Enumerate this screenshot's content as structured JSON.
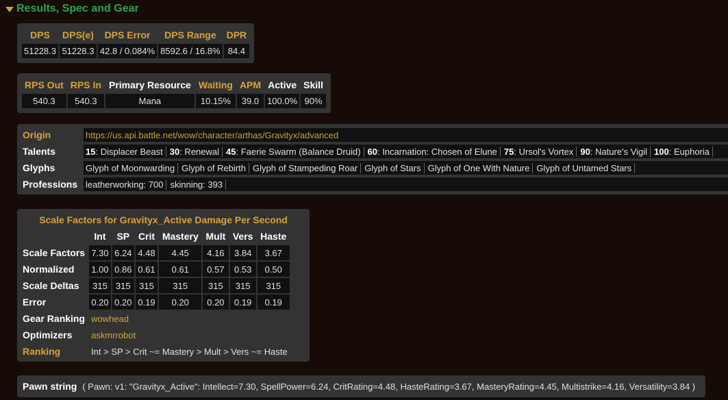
{
  "section": {
    "title": "Results, Spec and Gear"
  },
  "dps_table": {
    "headers": [
      "DPS",
      "DPS(e)",
      "DPS Error",
      "DPS Range",
      "DPR"
    ],
    "values": [
      "51228.3",
      "51228.3",
      "42.8 / 0.084%",
      "8592.6 / 16.8%",
      "84.4"
    ]
  },
  "rps_table": {
    "headers": [
      "RPS Out",
      "RPS In",
      "Primary Resource",
      "Waiting",
      "APM",
      "Active",
      "Skill"
    ],
    "header_colors": [
      "gold",
      "gold",
      "white",
      "gold",
      "gold",
      "white",
      "white"
    ],
    "values": [
      "540.3",
      "540.3",
      "Mana",
      "10.15%",
      "39.0",
      "100.0%",
      "90%"
    ]
  },
  "profile": {
    "origin_label": "Origin",
    "origin_url": "https://us.api.battle.net/wow/character/arthas/Gravityx/advanced",
    "talents_label": "Talents",
    "talents": [
      {
        "level": "15",
        "name": ": Displacer Beast"
      },
      {
        "level": "30",
        "name": ": Renewal"
      },
      {
        "level": "45",
        "name": ": Faerie Swarm (Balance Druid)"
      },
      {
        "level": "60",
        "name": ": Incarnation: Chosen of Elune"
      },
      {
        "level": "75",
        "name": ": Ursol's Vortex"
      },
      {
        "level": "90",
        "name": ": Nature's Vigil"
      },
      {
        "level": "100",
        "name": ": Euphoria"
      }
    ],
    "glyphs_label": "Glyphs",
    "glyphs": [
      "Glyph of Moonwarding",
      "Glyph of Rebirth",
      "Glyph of Stampeding Roar",
      "Glyph of Stars",
      "Glyph of One With Nature",
      "Glyph of Untamed Stars"
    ],
    "professions_label": "Professions",
    "professions": [
      "leatherworking: 700",
      "skinning: 393"
    ]
  },
  "scale_factors": {
    "caption": "Scale Factors for Gravityx_Active Damage Per Second",
    "columns": [
      "Int",
      "SP",
      "Crit",
      "Mastery",
      "Mult",
      "Vers",
      "Haste"
    ],
    "rows": [
      {
        "label": "Scale Factors",
        "values": [
          "7.30",
          "6.24",
          "4.48",
          "4.45",
          "4.16",
          "3.84",
          "3.67"
        ]
      },
      {
        "label": "Normalized",
        "values": [
          "1.00",
          "0.86",
          "0.61",
          "0.61",
          "0.57",
          "0.53",
          "0.50"
        ]
      },
      {
        "label": "Scale Deltas",
        "values": [
          "315",
          "315",
          "315",
          "315",
          "315",
          "315",
          "315"
        ]
      },
      {
        "label": "Error",
        "values": [
          "0.20",
          "0.20",
          "0.19",
          "0.20",
          "0.20",
          "0.19",
          "0.19"
        ]
      }
    ],
    "gear_ranking_label": "Gear Ranking",
    "gear_ranking_link": "wowhead",
    "optimizers_label": "Optimizers",
    "optimizers_link": "askmrrobot",
    "ranking_label": "Ranking",
    "ranking_value": "Int > SP > Crit ~= Mastery > Mult > Vers ~= Haste"
  },
  "pawn": {
    "label": "Pawn string",
    "value": "( Pawn: v1: \"Gravityx_Active\": Intellect=7.30, SpellPower=6.24, CritRating=4.48, HasteRating=3.67, MasteryRating=4.45, Multistrike=4.16, Versatility=3.84 )"
  },
  "colors": {
    "section_title": "#2ea44f",
    "gold": "#d8a33b",
    "background": "#160b07",
    "panel": "#333333",
    "cell": "#111111"
  }
}
